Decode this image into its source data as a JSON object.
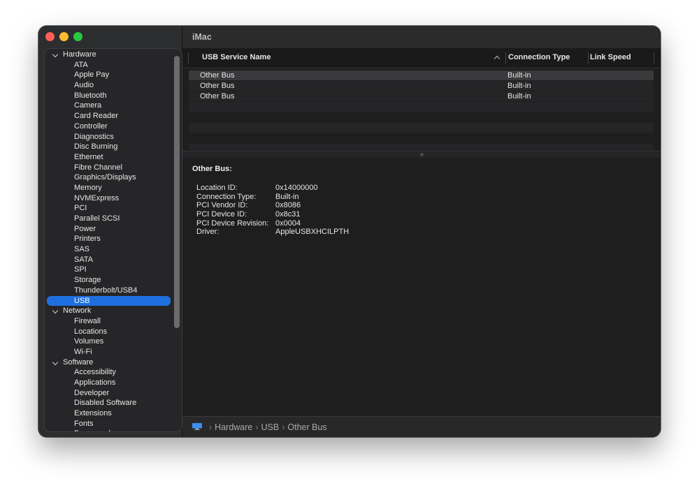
{
  "window": {
    "title": "iMac"
  },
  "sidebar": {
    "groups": [
      {
        "label": "Hardware",
        "items": [
          "ATA",
          "Apple Pay",
          "Audio",
          "Bluetooth",
          "Camera",
          "Card Reader",
          "Controller",
          "Diagnostics",
          "Disc Burning",
          "Ethernet",
          "Fibre Channel",
          "Graphics/Displays",
          "Memory",
          "NVMExpress",
          "PCI",
          "Parallel SCSI",
          "Power",
          "Printers",
          "SAS",
          "SATA",
          "SPI",
          "Storage",
          "Thunderbolt/USB4",
          "USB"
        ]
      },
      {
        "label": "Network",
        "items": [
          "Firewall",
          "Locations",
          "Volumes",
          "Wi-Fi"
        ]
      },
      {
        "label": "Software",
        "items": [
          "Accessibility",
          "Applications",
          "Developer",
          "Disabled Software",
          "Extensions",
          "Fonts",
          "Frameworks"
        ]
      }
    ],
    "selected": "USB"
  },
  "table": {
    "columns": [
      "USB Service Name",
      "Connection Type",
      "Link Speed"
    ],
    "rows": [
      {
        "name": "Other Bus",
        "type": "Built-in"
      },
      {
        "name": "Other Bus",
        "type": "Built-in"
      },
      {
        "name": "Other Bus",
        "type": "Built-in"
      }
    ]
  },
  "detail": {
    "title": "Other Bus:",
    "fields": [
      {
        "k": "Location ID:",
        "v": "0x14000000"
      },
      {
        "k": "Connection Type:",
        "v": "Built-in"
      },
      {
        "k": "PCI Vendor ID:",
        "v": "0x8086"
      },
      {
        "k": "PCI Device ID:",
        "v": "0x8c31"
      },
      {
        "k": "PCI Device Revision:",
        "v": "0x0004"
      },
      {
        "k": "Driver:",
        "v": "AppleUSBXHCILPTH"
      }
    ]
  },
  "breadcrumb": [
    "Hardware",
    "USB",
    "Other Bus"
  ],
  "colors": {
    "selection": "#1f6fe0",
    "close": "#ff5f57",
    "minimize": "#febc2e",
    "maximize": "#28c840"
  },
  "icons": {
    "path_bar": "computer-icon",
    "sort": "sort-ascending-icon"
  }
}
